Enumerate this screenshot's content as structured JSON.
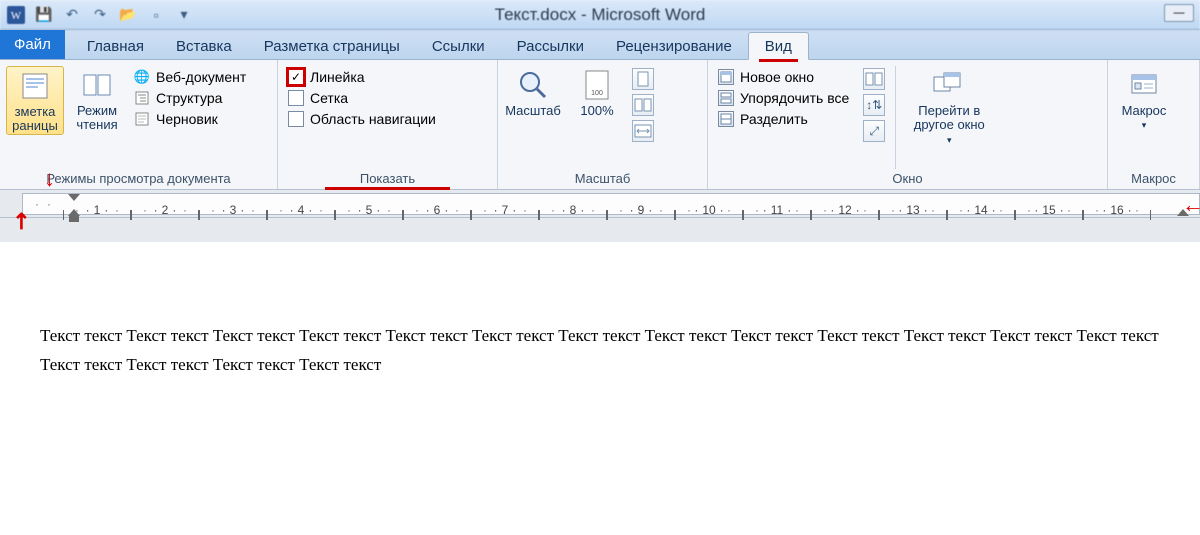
{
  "title": "Текст.docx - Microsoft Word",
  "tabs": {
    "file": "Файл",
    "home": "Главная",
    "insert": "Вставка",
    "layout": "Разметка страницы",
    "refs": "Ссылки",
    "mail": "Рассылки",
    "review": "Рецензирование",
    "view": "Вид"
  },
  "groups": {
    "views": {
      "label": "Режимы просмотра документа",
      "pageLayout": "зметка\nраницы",
      "reading": "Режим\nчтения",
      "web": "Веб-документ",
      "outline": "Структура",
      "draft": "Черновик"
    },
    "show": {
      "label": "Показать",
      "ruler": "Линейка",
      "grid": "Сетка",
      "nav": "Область навигации"
    },
    "zoom": {
      "label": "Масштаб",
      "zoom": "Масштаб",
      "hundred": "100%"
    },
    "window": {
      "label": "Окно",
      "newwin": "Новое окно",
      "arrange": "Упорядочить все",
      "split": "Разделить",
      "switch": "Перейти в\nдругое окно"
    },
    "macros": {
      "label": "Макрос",
      "macros": "Макрос"
    }
  },
  "ruler_numbers": [
    "1",
    "2",
    "3",
    "4",
    "5",
    "6",
    "7",
    "8",
    "9",
    "10",
    "11",
    "12",
    "13",
    "14",
    "15",
    "16"
  ],
  "doc_text": "Текст текст Текст текст Текст текст Текст текст Текст текст Текст текст Текст текст Текст текст Текст текст Текст текст Текст текст Текст текст Текст текст Текст текст Текст текст Текст текст Текст текст"
}
